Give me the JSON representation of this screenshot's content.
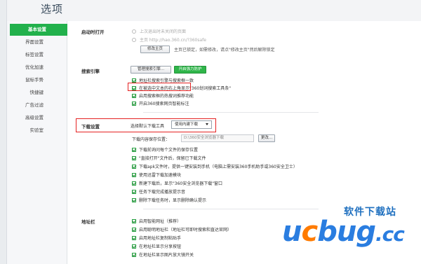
{
  "page_title": "选项",
  "sidebar": {
    "items": [
      {
        "label": "基本设置",
        "active": true
      },
      {
        "label": "界面设置"
      },
      {
        "label": "标签设置"
      },
      {
        "label": "优化加速"
      },
      {
        "label": "鼠标手势"
      },
      {
        "label": "快捷键"
      },
      {
        "label": "广告过滤"
      },
      {
        "label": "高级设置"
      },
      {
        "label": "实验室"
      }
    ]
  },
  "startup": {
    "label": "启动时打开",
    "opt_last": "上次退出时未关闭的页面",
    "opt_home": "主页  http://hao.360.cn/?360safe",
    "edit_btn": "修改主页",
    "lock_note": "主页已锁定，如需修改，请点\"修改主页\"然后解除锁定"
  },
  "search": {
    "label": "搜索引擎",
    "manage_btn": "管理搜索引擎...",
    "protect_btn": "开启强力防护",
    "options": [
      "地址栏搜索引擎与搜索框一致",
      "在被选中文本的右上角显示\"360划词搜索工具条\"",
      "启用搜索框的热搜词推荐功能",
      "开启360搜索网页智能标注"
    ]
  },
  "download": {
    "label": "下载设置",
    "tool_label": "选择默认下载工具",
    "tool_value": "使用内建下载",
    "location_label": "下载内容保存位置：",
    "location_value": "D:\\360安全浏览器下载",
    "change_btn": "更改...",
    "options": [
      "下载前询问每个文件的保存位置",
      "\"直接打开\"文件后，保留已下载文件",
      "下载apk文件时，提供一键安装到手机（电脑上需安装360手机助手或360安全卫士）",
      "使用迅雷下载加速模块",
      "新建下载后，显示\"360安全浏览器下载\"窗口",
      "任务下载完成播放提示音",
      "删除下载任务时，显示删除确认提示"
    ]
  },
  "address": {
    "label": "地址栏",
    "options": [
      "启用智能网址（推荐）",
      "启用聪明地址栏（地址栏可即时搜索和直达官网）",
      "启用地址栏复制粘贴手",
      "在地址栏显示分享按钮",
      "在地址栏显示图片放大镜开关"
    ]
  },
  "watermark": {
    "cn": "软件下载站",
    "logo_u": "u",
    "logo_c": "c",
    "logo_bug": "bug",
    "logo_tld": ".cc"
  },
  "colors": {
    "accent_green": "#22b14c",
    "highlight_red": "#e52222",
    "logo_blue": "#2a7de0",
    "logo_orange": "#ff7b00"
  }
}
